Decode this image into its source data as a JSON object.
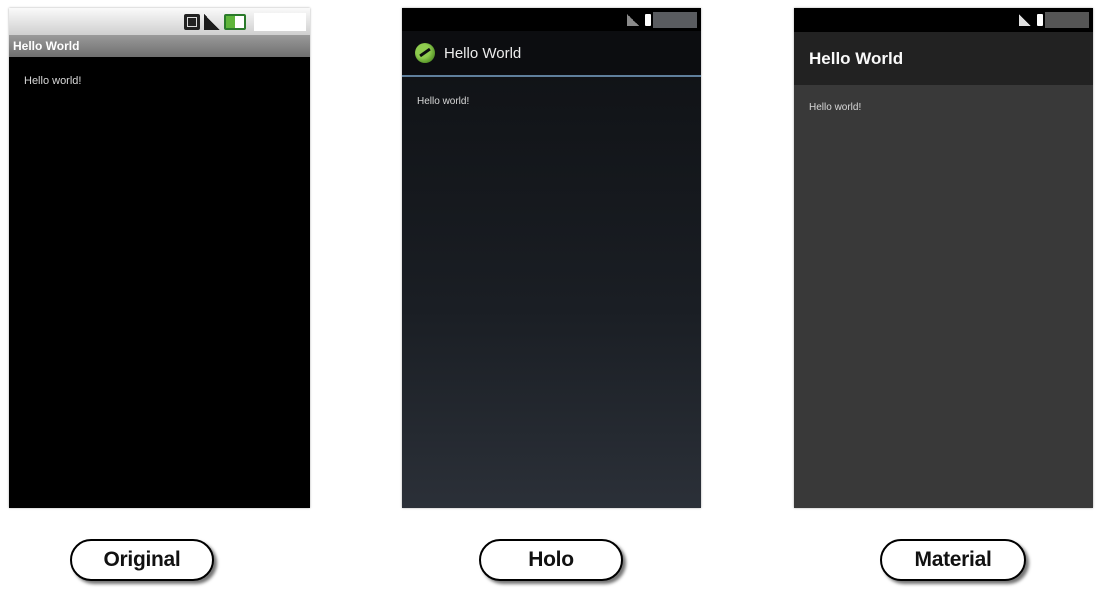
{
  "screens": [
    {
      "key": "original",
      "app_title": "Hello World",
      "body_text": "Hello world!",
      "caption": "Original",
      "status_icons": [
        "3g-icon",
        "signal-icon",
        "battery-charging-icon"
      ]
    },
    {
      "key": "holo",
      "app_title": "Hello World",
      "body_text": "Hello world!",
      "caption": "Holo",
      "status_icons": [
        "no-signal-icon",
        "battery-icon"
      ]
    },
    {
      "key": "material",
      "app_title": "Hello World",
      "body_text": "Hello world!",
      "caption": "Material",
      "status_icons": [
        "no-signal-icon",
        "battery-icon"
      ]
    }
  ],
  "colors": {
    "original_background": "#000000",
    "original_title_bar": "#808080",
    "holo_accent_line": "#5f7f9c",
    "holo_logo": "#7dbd42",
    "material_app_bar": "#222222",
    "material_background": "#393939"
  }
}
